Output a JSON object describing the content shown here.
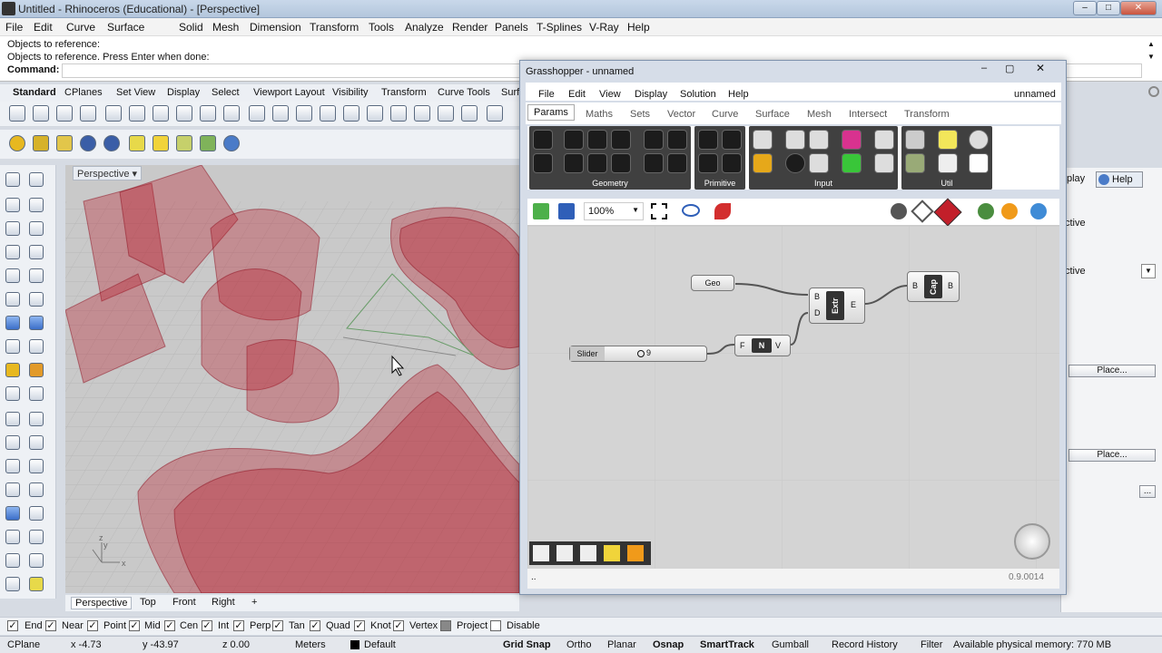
{
  "window": {
    "title": "Untitled - Rhinoceros (Educational) - [Perspective]"
  },
  "menu": [
    "File",
    "Edit",
    "Curve",
    "Surface",
    "Solid",
    "Mesh",
    "Dimension",
    "Transform",
    "Tools",
    "Analyze",
    "Render",
    "Panels",
    "T-Splines",
    "V-Ray",
    "Help"
  ],
  "command": {
    "lines": [
      "Objects to reference:",
      "Objects to reference. Press Enter when done:"
    ],
    "label": "Command:"
  },
  "toolbar_tabs": [
    "Standard",
    "CPlanes",
    "Set View",
    "Display",
    "Select",
    "Viewport Layout",
    "Visibility",
    "Transform",
    "Curve Tools",
    "Surf"
  ],
  "viewport": {
    "label": "Perspective",
    "axis_x": "x",
    "axis_z": "z",
    "axis_y": "y"
  },
  "view_tabs": [
    "Perspective",
    "Top",
    "Front",
    "Right",
    "+"
  ],
  "osnap": [
    {
      "label": "End",
      "checked": true
    },
    {
      "label": "Near",
      "checked": true
    },
    {
      "label": "Point",
      "checked": true
    },
    {
      "label": "Mid",
      "checked": true
    },
    {
      "label": "Cen",
      "checked": true
    },
    {
      "label": "Int",
      "checked": true
    },
    {
      "label": "Perp",
      "checked": true
    },
    {
      "label": "Tan",
      "checked": true
    },
    {
      "label": "Quad",
      "checked": true
    },
    {
      "label": "Knot",
      "checked": true
    },
    {
      "label": "Vertex",
      "checked": true
    },
    {
      "label": "Project",
      "checked": false
    },
    {
      "label": "Disable",
      "checked": false
    }
  ],
  "status": {
    "cplane": "CPlane",
    "x": "x -4.73",
    "y": "y -43.97",
    "z": "z 0.00",
    "units": "Meters",
    "layer": "Default",
    "toggles": [
      "Grid Snap",
      "Ortho",
      "Planar",
      "Osnap",
      "SmartTrack",
      "Gumball",
      "Record History",
      "Filter"
    ],
    "memory": "Available physical memory: 770 MB"
  },
  "right_panel": {
    "tabs": [
      "play",
      "Help"
    ],
    "items": [
      "ctive",
      "ctive"
    ],
    "place1": "Place...",
    "place2": "Place...",
    "dots": "..."
  },
  "grasshopper": {
    "title": "Grasshopper - unnamed",
    "doc": "unnamed",
    "menu": [
      "File",
      "Edit",
      "View",
      "Display",
      "Solution",
      "Help"
    ],
    "tabs": [
      "Params",
      "Maths",
      "Sets",
      "Vector",
      "Curve",
      "Surface",
      "Mesh",
      "Intersect",
      "Transform"
    ],
    "groups": [
      "Geometry",
      "Primitive",
      "Input",
      "Util"
    ],
    "zoom": "100%",
    "version": "0.9.0014",
    "footer": "..",
    "components": {
      "geo": "Geo",
      "slider": "Slider",
      "slider_value": "9",
      "extr": "Extr",
      "extr_b": "B",
      "extr_d": "D",
      "extr_e": "E",
      "n": "N",
      "n_f": "F",
      "n_v": "V",
      "cap": "Cap",
      "cap_in": "B",
      "cap_out": "B"
    }
  }
}
